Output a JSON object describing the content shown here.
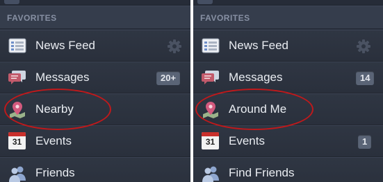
{
  "colors": {
    "panel_bg": "#2c3340",
    "header_text": "#8790a3",
    "row_text": "#e9ecf1",
    "badge_bg": "#5a6476",
    "highlight_ring": "#c0191b"
  },
  "left_panel": {
    "section_title": "FAVORITES",
    "items": [
      {
        "label": "News Feed",
        "icon": "news-feed-icon",
        "accessory": "gear-icon"
      },
      {
        "label": "Messages",
        "icon": "messages-icon",
        "badge": "20+"
      },
      {
        "label": "Nearby",
        "icon": "location-pin-icon",
        "highlighted": true
      },
      {
        "label": "Events",
        "icon": "calendar-icon",
        "calendar_day": "31"
      },
      {
        "label": "Friends",
        "icon": "friends-icon"
      }
    ]
  },
  "right_panel": {
    "section_title": "FAVORITES",
    "items": [
      {
        "label": "News Feed",
        "icon": "news-feed-icon",
        "accessory": "gear-icon"
      },
      {
        "label": "Messages",
        "icon": "messages-icon",
        "badge": "14"
      },
      {
        "label": "Around Me",
        "icon": "location-pin-icon",
        "highlighted": true
      },
      {
        "label": "Events",
        "icon": "calendar-icon",
        "calendar_day": "31",
        "badge": "1"
      },
      {
        "label": "Find Friends",
        "icon": "friends-icon"
      }
    ]
  }
}
